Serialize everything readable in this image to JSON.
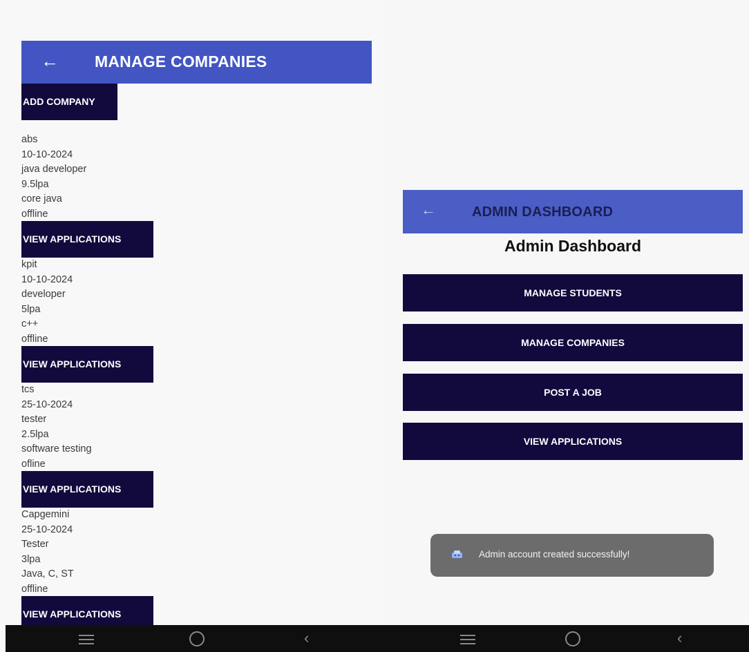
{
  "left": {
    "appbar": {
      "back_icon": "arrow-left-icon",
      "title": "MANAGE COMPANIES"
    },
    "add_company_label": "ADD COMPANY",
    "companies": [
      {
        "name": "abs",
        "date": "10-10-2024",
        "role": "java developer",
        "package": "9.5lpa",
        "skills": "core java",
        "mode": "offline",
        "button": "VIEW APPLICATIONS"
      },
      {
        "name": "kpit",
        "date": "10-10-2024",
        "role": "developer",
        "package": "5lpa",
        "skills": "c++",
        "mode": "offline",
        "button": "VIEW APPLICATIONS"
      },
      {
        "name": "tcs",
        "date": "25-10-2024",
        "role": "tester",
        "package": "2.5lpa",
        "skills": "software testing",
        "mode": "ofline",
        "button": "VIEW APPLICATIONS"
      },
      {
        "name": "Capgemini",
        "date": "25-10-2024",
        "role": "Tester",
        "package": "3lpa",
        "skills": "Java, C, ST",
        "mode": "offline",
        "button": "VIEW APPLICATIONS"
      }
    ]
  },
  "right": {
    "appbar": {
      "back_icon": "arrow-left-icon",
      "title": "ADMIN DASHBOARD"
    },
    "heading": "Admin Dashboard",
    "buttons": [
      "MANAGE STUDENTS",
      "MANAGE COMPANIES",
      "POST A JOB",
      "VIEW APPLICATIONS"
    ],
    "toast": {
      "icon": "app-icon",
      "message": "Admin account created successfully!"
    }
  },
  "navbar": {
    "icons": [
      "menu-icon",
      "home-circle-icon",
      "back-chevron-icon"
    ]
  },
  "colors": {
    "appbar": "#4255c2",
    "button": "#120a3d",
    "toast": "#6c6c6c"
  }
}
